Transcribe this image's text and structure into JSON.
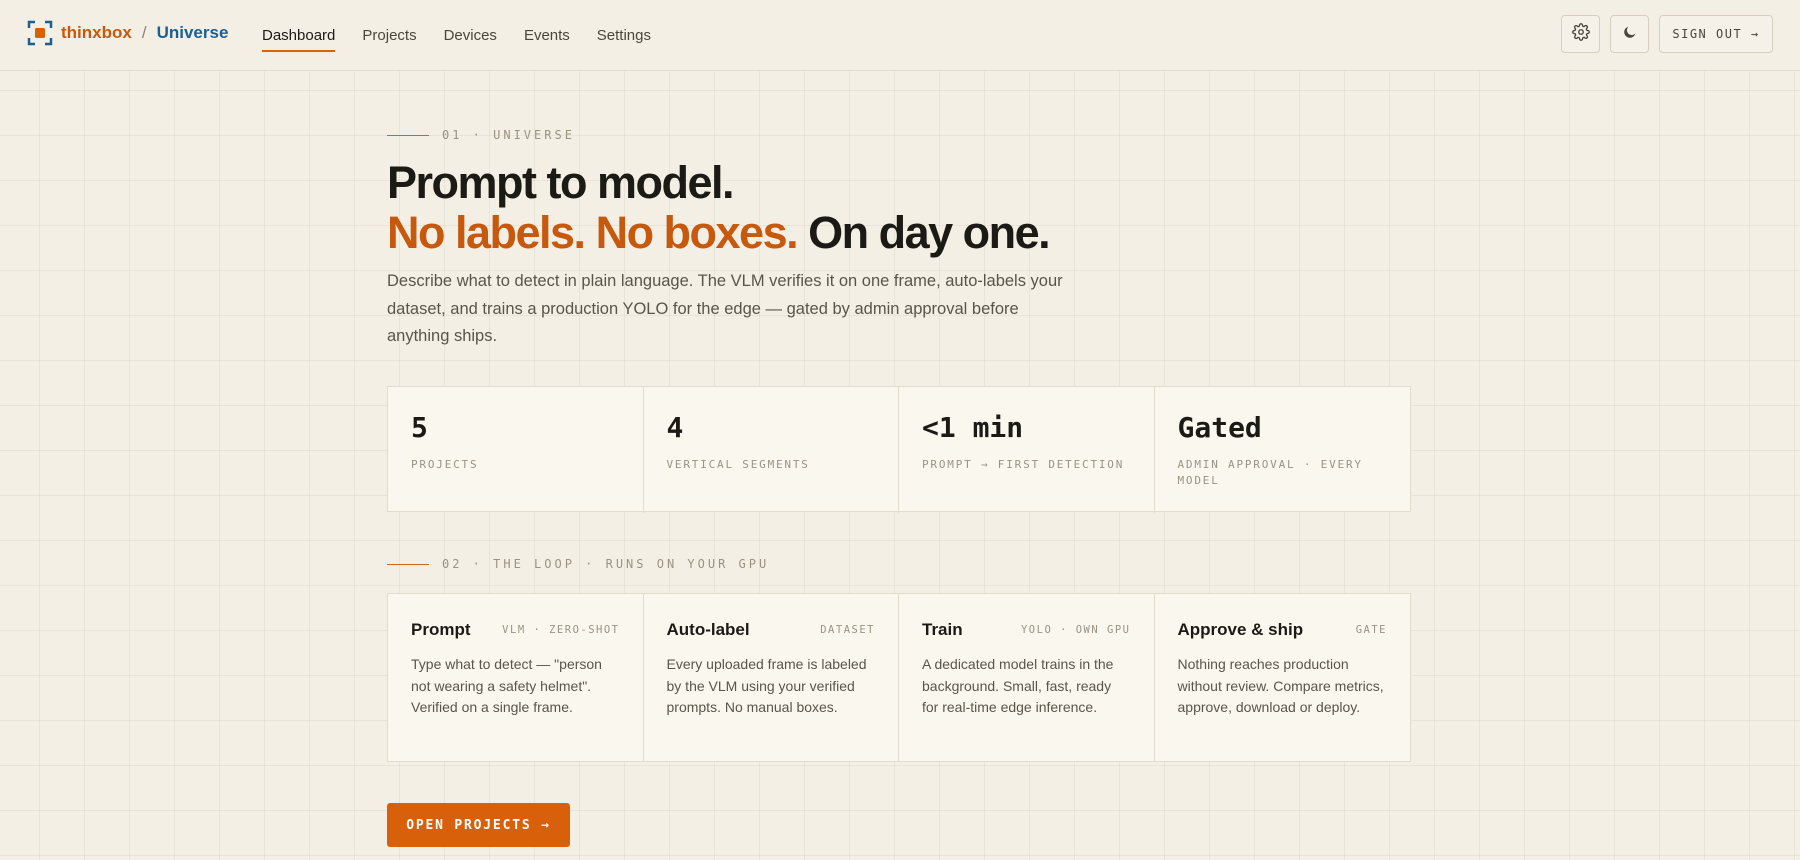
{
  "header": {
    "brand": {
      "name": "thinxbox",
      "separator": "/",
      "product": "Universe"
    },
    "nav": [
      {
        "label": "Dashboard",
        "active": true
      },
      {
        "label": "Projects",
        "active": false
      },
      {
        "label": "Devices",
        "active": false
      },
      {
        "label": "Events",
        "active": false
      },
      {
        "label": "Settings",
        "active": false
      }
    ],
    "settings_icon": "gear-icon",
    "theme_icon": "moon-icon",
    "sign_out_label": "SIGN OUT →"
  },
  "hero": {
    "eyebrow": "01 · UNIVERSE",
    "title_line1": "Prompt to model.",
    "title_accent": "No labels. No boxes.",
    "title_rest": "On day one.",
    "lede": "Describe what to detect in plain language. The VLM verifies it on one frame, auto-labels your dataset, and trains a production YOLO for the edge — gated by admin approval before anything ships."
  },
  "stats": [
    {
      "value": "5",
      "label": "PROJECTS"
    },
    {
      "value": "4",
      "label": "VERTICAL SEGMENTS"
    },
    {
      "value": "<1 min",
      "label": "PROMPT → FIRST DETECTION"
    },
    {
      "value": "Gated",
      "label": "ADMIN APPROVAL · EVERY MODEL"
    }
  ],
  "loop": {
    "eyebrow": "02 · THE LOOP · RUNS ON YOUR GPU",
    "steps": [
      {
        "title": "Prompt",
        "tag": "VLM · ZERO-SHOT",
        "desc": "Type what to detect — \"person not wearing a safety helmet\". Verified on a single frame."
      },
      {
        "title": "Auto-label",
        "tag": "DATASET",
        "desc": "Every uploaded frame is labeled by the VLM using your verified prompts. No manual boxes."
      },
      {
        "title": "Train",
        "tag": "YOLO · OWN GPU",
        "desc": "A dedicated model trains in the background. Small, fast, ready for real-time edge inference."
      },
      {
        "title": "Approve & ship",
        "tag": "GATE",
        "desc": "Nothing reaches production without review. Compare metrics, approve, download or deploy."
      }
    ]
  },
  "cta": {
    "label": "OPEN PROJECTS →"
  },
  "colors": {
    "accent": "#d9600b",
    "brand_orange": "#c7590e",
    "brand_blue": "#1d5f93",
    "background": "#f3efe5"
  }
}
